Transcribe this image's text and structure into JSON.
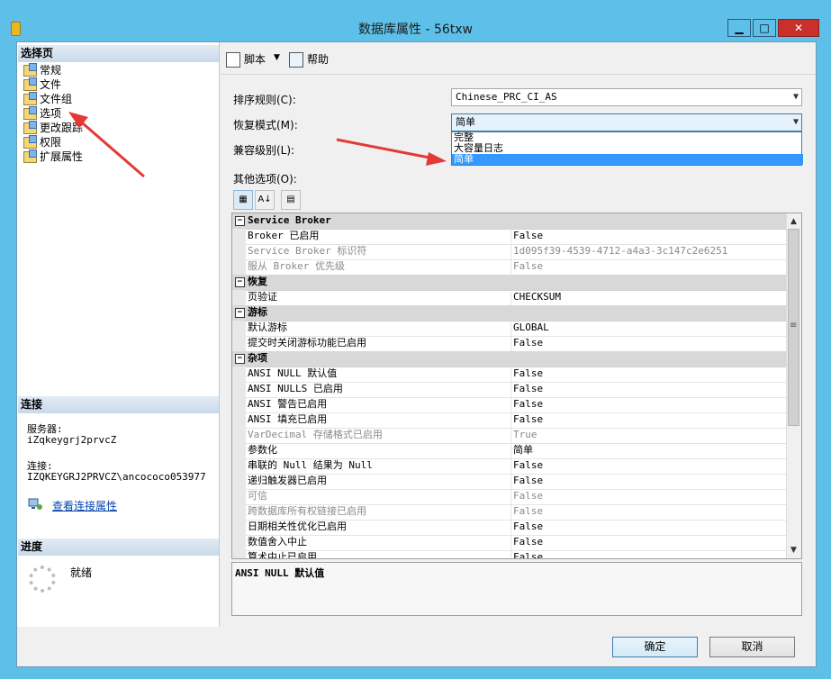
{
  "window": {
    "title": "数据库属性 - 56txw",
    "controls": [
      "▁",
      "□",
      "✕"
    ]
  },
  "left": {
    "select_page_header": "选择页",
    "pages": [
      "常规",
      "文件",
      "文件组",
      "选项",
      "更改跟踪",
      "权限",
      "扩展属性"
    ],
    "connection_header": "连接",
    "server_label": "服务器:",
    "server_value": "iZqkeygrj2prvcZ",
    "connection_label": "连接:",
    "connection_value": "IZQKEYGRJ2PRVCZ\\ancococo053977",
    "view_connection_link": "查看连接属性",
    "progress_header": "进度",
    "progress_status": "就绪"
  },
  "toolbar": {
    "script_label": "脚本",
    "help_label": "帮助"
  },
  "form": {
    "collation_label": "排序规则(C):",
    "collation_value": "Chinese_PRC_CI_AS",
    "recovery_label": "恢复模式(M):",
    "recovery_value": "简单",
    "recovery_options": [
      "完整",
      "大容量日志",
      "简单"
    ],
    "compat_label": "兼容级别(L):",
    "other_label": "其他选项(O):"
  },
  "grid": {
    "rows": [
      {
        "type": "cat",
        "name": "Service Broker"
      },
      {
        "name": "Broker 已启用",
        "value": "False"
      },
      {
        "name": "Service Broker 标识符",
        "value": "1d095f39-4539-4712-a4a3-3c147c2e6251",
        "dim": true
      },
      {
        "name": "服从 Broker 优先级",
        "value": "False",
        "dim": true
      },
      {
        "type": "cat",
        "name": "恢复"
      },
      {
        "name": "页验证",
        "value": "CHECKSUM"
      },
      {
        "type": "cat",
        "name": "游标"
      },
      {
        "name": "默认游标",
        "value": "GLOBAL"
      },
      {
        "name": "提交时关闭游标功能已启用",
        "value": "False"
      },
      {
        "type": "cat",
        "name": "杂项"
      },
      {
        "name": "ANSI NULL 默认值",
        "value": "False"
      },
      {
        "name": "ANSI NULLS 已启用",
        "value": "False"
      },
      {
        "name": "ANSI 警告已启用",
        "value": "False"
      },
      {
        "name": "ANSI 填充已启用",
        "value": "False"
      },
      {
        "name": "VarDecimal 存储格式已启用",
        "value": "True",
        "dim": true
      },
      {
        "name": "参数化",
        "value": "简单"
      },
      {
        "name": "串联的 Null 结果为 Null",
        "value": "False"
      },
      {
        "name": "递归触发器已启用",
        "value": "False"
      },
      {
        "name": "可信",
        "value": "False",
        "dim": true
      },
      {
        "name": "跨数据库所有权链接已启用",
        "value": "False",
        "dim": true
      },
      {
        "name": "日期相关性优化已启用",
        "value": "False"
      },
      {
        "name": "数值舍入中止",
        "value": "False"
      },
      {
        "name": "算术中止已启用",
        "value": "False"
      }
    ],
    "description_title": "ANSI NULL 默认值"
  },
  "buttons": {
    "ok": "确定",
    "cancel": "取消"
  },
  "colors": {
    "accent": "#5ec0e8",
    "selection": "#3399ff",
    "annotation": "#e53935"
  }
}
